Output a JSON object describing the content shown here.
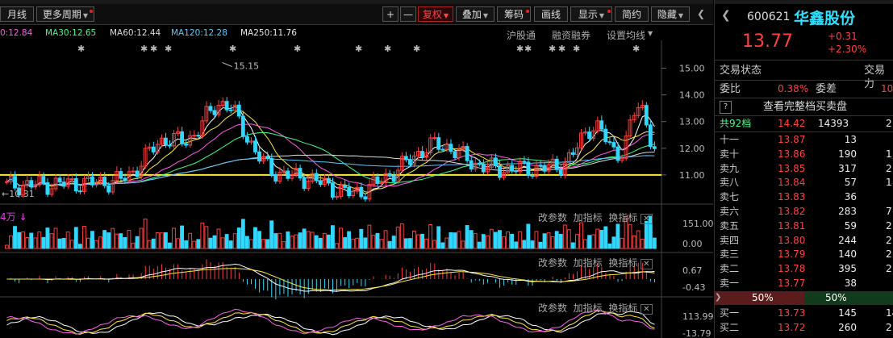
{
  "toolbar": {
    "month_line": "月线",
    "more_period": "更多周期",
    "plus": "+",
    "minus": "—",
    "fuquan": "复权",
    "diejia": "叠加",
    "choumа": "筹码",
    "huaxian": "画线",
    "xianshi": "显示",
    "jianyue": "简约",
    "yincang": "隐藏"
  },
  "ma_row": {
    "ma20": "0:12.84",
    "ma30": "MA30:12.65",
    "ma60": "MA60:12.44",
    "ma120": "MA120:12.28",
    "ma250": "MA250:11.76",
    "hugutong": "沪股通",
    "rongzi": "融资融券",
    "shezhi": "设置均线"
  },
  "chart_data": [
    {
      "type": "candlestick",
      "title": "",
      "y_ticks": [
        "15.00",
        "14.00",
        "13.00",
        "12.00",
        "11.00"
      ],
      "ylim": [
        10.0,
        15.5
      ],
      "annotations": [
        {
          "label": "15.15"
        },
        {
          "label": "10.31"
        }
      ],
      "support_line": 11.0
    },
    {
      "type": "bar",
      "title": "4万",
      "y_ticks": [
        "151.00",
        "0.00"
      ]
    },
    {
      "type": "line",
      "y_ticks": [
        "0.67",
        "-0.43"
      ]
    },
    {
      "type": "line",
      "y_ticks": [
        "113.99",
        "-13.79"
      ]
    }
  ],
  "sub_tools": {
    "gai": "改参数",
    "jia": "加指标",
    "huan": "换指标",
    "close": "✕"
  },
  "panel": {
    "code": "600621",
    "name": "华鑫股份",
    "price": "13.77",
    "change": "+0.31",
    "pct": "+2.30%",
    "trade_status": "交易状态",
    "trade_status_r": "交易力",
    "weibi_label": "委比",
    "weibi_val": "0.38%",
    "weicha_label": "委差",
    "weicha_val": "10",
    "q_mark": "?",
    "full_book": "查看完整档买卖盘",
    "total_label": "共92档",
    "total_price": "14.42",
    "total_vol": "14393",
    "total_extra": "2",
    "asks": [
      {
        "label": "十一",
        "price": "13.87",
        "vol": "13",
        "extra": ""
      },
      {
        "label": "卖十",
        "price": "13.86",
        "vol": "190",
        "extra": "1"
      },
      {
        "label": "卖九",
        "price": "13.85",
        "vol": "317",
        "extra": "2"
      },
      {
        "label": "卖八",
        "price": "13.84",
        "vol": "57",
        "extra": "1"
      },
      {
        "label": "卖七",
        "price": "13.83",
        "vol": "36",
        "extra": ""
      },
      {
        "label": "卖六",
        "price": "13.82",
        "vol": "283",
        "extra": "7"
      },
      {
        "label": "卖五",
        "price": "13.81",
        "vol": "59",
        "extra": "2"
      },
      {
        "label": "卖四",
        "price": "13.80",
        "vol": "244",
        "extra": "2"
      },
      {
        "label": "卖三",
        "price": "13.79",
        "vol": "140",
        "extra": "2"
      },
      {
        "label": "卖二",
        "price": "13.78",
        "vol": "395",
        "extra": "2"
      },
      {
        "label": "卖一",
        "price": "13.77",
        "vol": "38",
        "extra": ""
      }
    ],
    "ratio_left": "50%",
    "ratio_right": "50%",
    "bids": [
      {
        "label": "买一",
        "price": "13.73",
        "vol": "145",
        "extra": "14"
      },
      {
        "label": "买二",
        "price": "13.72",
        "vol": "260",
        "extra": "2"
      }
    ]
  }
}
